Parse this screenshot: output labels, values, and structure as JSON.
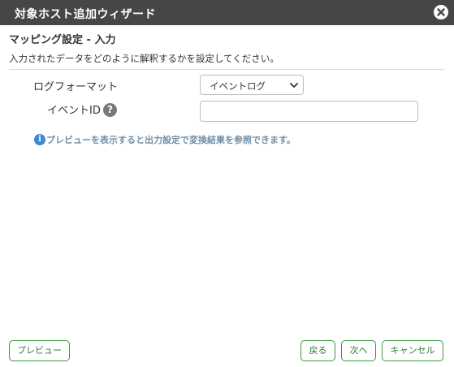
{
  "dialog": {
    "title": "対象ホスト追加ウィザード",
    "section_title": "マッピング設定 - 入力",
    "description": "入力されたデータをどのように解釈するかを設定してください。"
  },
  "form": {
    "log_format": {
      "label": "ログフォーマット",
      "selected": "イベントログ"
    },
    "event_id": {
      "label": "イベントID",
      "value": "",
      "placeholder": ""
    },
    "info_text": "プレビューを表示すると出力設定で変換結果を参照できます。"
  },
  "buttons": {
    "preview": "プレビュー",
    "back": "戻る",
    "next": "次へ",
    "cancel": "キャンセル"
  },
  "icons": {
    "close": "close-icon",
    "help": "help-icon",
    "info": "info-icon",
    "dropdown": "chevron-down-icon"
  },
  "colors": {
    "titlebar": "#464646",
    "button_border": "#3a9a3a",
    "info_icon": "#3a8ad3",
    "info_text": "#6f8fa8"
  }
}
